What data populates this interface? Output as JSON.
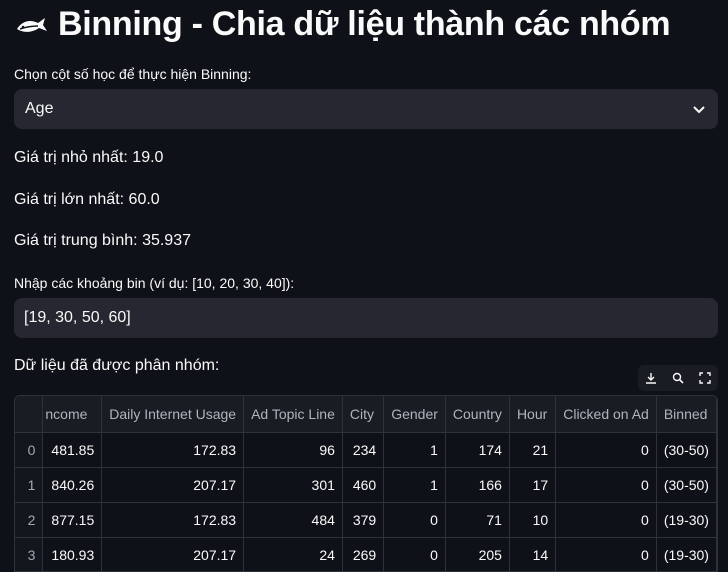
{
  "header": {
    "title": "Binning - Chia dữ liệu thành các nhóm",
    "icon": "fish-icon"
  },
  "column_select": {
    "label": "Chọn cột số học để thực hiện Binning:",
    "value": "Age"
  },
  "stats": {
    "min": "Giá trị nhỏ nhất: 19.0",
    "max": "Giá trị lớn nhất: 60.0",
    "mean": "Giá trị trung bình: 35.937"
  },
  "bins_input": {
    "label": "Nhập các khoảng bin (ví dụ: [10, 20, 30, 40]):",
    "value": "[19, 30, 50, 60]"
  },
  "result": {
    "heading": "Dữ liệu đã được phân nhóm:"
  },
  "table": {
    "columns": [
      "ncome",
      "Daily Internet Usage",
      "Ad Topic Line",
      "City",
      "Gender",
      "Country",
      "Hour",
      "Clicked on Ad",
      "Binned"
    ],
    "rows": [
      {
        "index": "0",
        "cells": [
          "481.85",
          "172.83",
          "96",
          "234",
          "1",
          "174",
          "21",
          "0",
          "(30-50)"
        ]
      },
      {
        "index": "1",
        "cells": [
          "840.26",
          "207.17",
          "301",
          "460",
          "1",
          "166",
          "17",
          "0",
          "(30-50)"
        ]
      },
      {
        "index": "2",
        "cells": [
          "877.15",
          "172.83",
          "484",
          "379",
          "0",
          "71",
          "10",
          "0",
          "(19-30)"
        ]
      },
      {
        "index": "3",
        "cells": [
          "180.93",
          "207.17",
          "24",
          "269",
          "0",
          "205",
          "14",
          "0",
          "(19-30)"
        ]
      }
    ]
  },
  "colors": {
    "background": "#0e1117",
    "widget": "#262730",
    "border": "#2f313b"
  }
}
